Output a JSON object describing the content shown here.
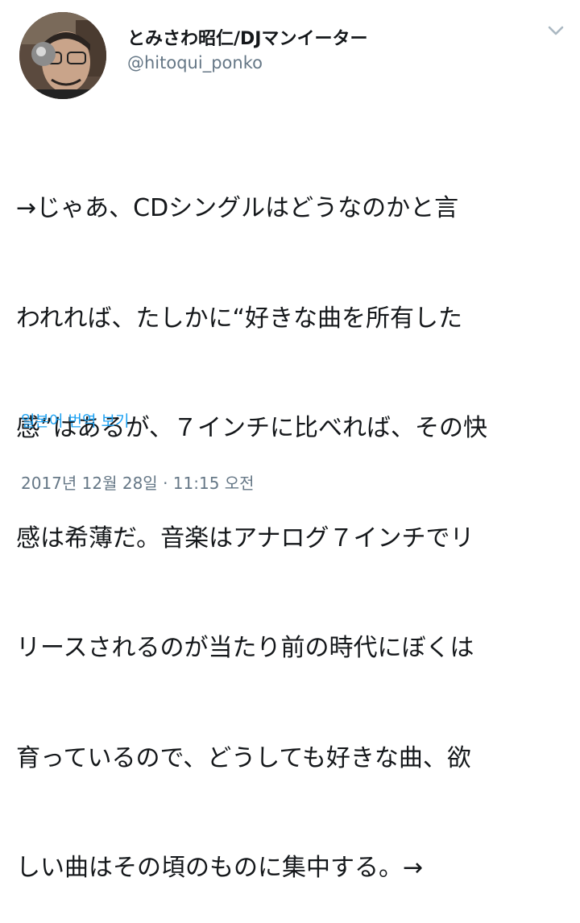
{
  "tweet": {
    "display_name": "とみさわ昭仁/DJマンイーター",
    "handle": "@hitoqui_ponko",
    "text_lines": [
      "→じゃあ、CDシングルはどうなのかと言",
      "われれば、たしかに“好きな曲を所有した",
      "感”はあるが、７インチに比べれば、その快",
      "感は希薄だ。音楽はアナログ７インチでリ",
      "リースされるのが当たり前の時代にぼくは",
      "育っているので、どうしても好きな曲、欲",
      "しい曲はその頃のものに集中する。→"
    ],
    "translate_label": "일본어 번역 보기",
    "timestamp": "2017년 12월 28일 · 11:15 오전"
  },
  "icons": {
    "avatar": "profile-photo",
    "menu": "chevron-down-icon"
  },
  "colors": {
    "text": "#14171a",
    "secondary": "#657786",
    "link": "#1da1f2",
    "chevron": "#aab8c2"
  }
}
